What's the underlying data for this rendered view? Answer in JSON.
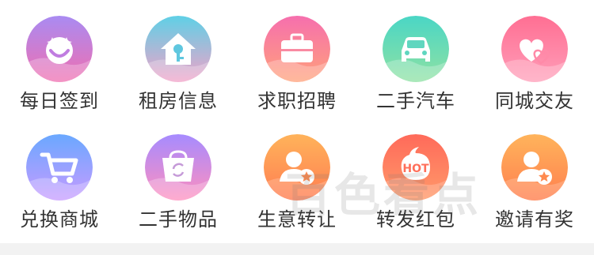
{
  "grid": {
    "items": [
      {
        "label": "每日签到",
        "icon": "smiley-stars-icon",
        "grad_top": "#a98bf2",
        "grad_bottom": "#f06fb0"
      },
      {
        "label": "租房信息",
        "icon": "house-key-icon",
        "grad_top": "#5fd0e6",
        "grad_bottom": "#f2a2c8"
      },
      {
        "label": "求职招聘",
        "icon": "briefcase-icon",
        "grad_top": "#f66fae",
        "grad_bottom": "#ffa17a"
      },
      {
        "label": "二手汽车",
        "icon": "car-icon",
        "grad_top": "#4ad6c5",
        "grad_bottom": "#8fe1a3"
      },
      {
        "label": "同城交友",
        "icon": "hearts-icon",
        "grad_top": "#ff6f93",
        "grad_bottom": "#ff9db8"
      },
      {
        "label": "兑换商城",
        "icon": "shopping-cart-icon",
        "grad_top": "#6aa8ff",
        "grad_bottom": "#c79bff"
      },
      {
        "label": "二手物品",
        "icon": "recycle-bag-icon",
        "grad_top": "#a68bff",
        "grad_bottom": "#ff8fbe"
      },
      {
        "label": "生意转让",
        "icon": "person-star-icon",
        "grad_top": "#ffb35a",
        "grad_bottom": "#ff7d52"
      },
      {
        "label": "转发红包",
        "icon": "hot-bubble-icon",
        "grad_top": "#ff6a5a",
        "grad_bottom": "#ff9a6a"
      },
      {
        "label": "邀请有奖",
        "icon": "person-star-icon",
        "grad_top": "#ffb45b",
        "grad_bottom": "#ff7f4f"
      }
    ]
  },
  "watermark": {
    "text": "百色看点"
  }
}
